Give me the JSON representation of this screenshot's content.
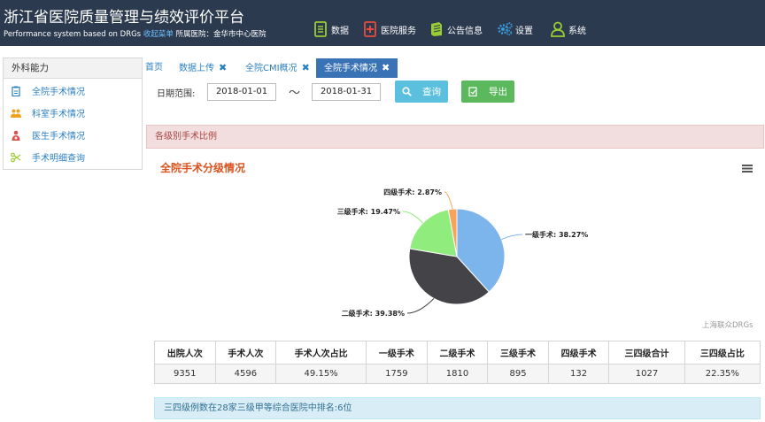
{
  "header": {
    "title": "浙江省医院质量管理与绩效评价平台",
    "subtitle_prefix": "Performance system based on DRGs",
    "subtitle_link": "收起菜单",
    "subtitle_hospital": "所属医院：金华市中心医院",
    "nav": [
      {
        "label": "数据",
        "icon": "document-icon"
      },
      {
        "label": "医院服务",
        "icon": "hospital-service-icon"
      },
      {
        "label": "公告信息",
        "icon": "book-icon"
      },
      {
        "label": "设置",
        "icon": "gear-icon"
      },
      {
        "label": "系统",
        "icon": "user-icon"
      }
    ]
  },
  "sidebar": {
    "title": "外科能力",
    "items": [
      {
        "label": "全院手术情况",
        "icon": "clipboard-icon",
        "color": "#2a7fc0"
      },
      {
        "label": "科室手术情况",
        "icon": "group-icon",
        "color": "#f0a020"
      },
      {
        "label": "医生手术情况",
        "icon": "doctor-icon",
        "color": "#d9534f"
      },
      {
        "label": "手术明细查询",
        "icon": "scissors-icon",
        "color": "#9acd32"
      }
    ]
  },
  "tabs": [
    {
      "label": "首页",
      "closable": false
    },
    {
      "label": "数据上传",
      "closable": true
    },
    {
      "label": "全院CMI概况",
      "closable": true
    },
    {
      "label": "全院手术情况",
      "closable": true,
      "active": true
    }
  ],
  "filter": {
    "date_label": "日期范围:",
    "start_date": "2018-01-01",
    "separator": "～",
    "end_date": "2018-01-31",
    "query_label": "查询",
    "export_label": "导出"
  },
  "panel": {
    "heading": "各级别手术比例",
    "credit": "上海联众DRGs"
  },
  "chart_data": {
    "type": "pie",
    "title": "全院手术分级情况",
    "slices": [
      {
        "name": "一级手术",
        "value": 38.27,
        "label": "一级手术: 38.27%",
        "color": "#7cb5ec"
      },
      {
        "name": "二级手术",
        "value": 39.38,
        "label": "二级手术: 39.38%",
        "color": "#434348"
      },
      {
        "name": "三级手术",
        "value": 19.47,
        "label": "三级手术: 19.47%",
        "color": "#90ed7d"
      },
      {
        "name": "四级手术",
        "value": 2.87,
        "label": "四级手术: 2.87%",
        "color": "#f7a35c"
      }
    ]
  },
  "table": {
    "headers": [
      "出院人次",
      "手术人次",
      "手术人次占比",
      "一级手术",
      "二级手术",
      "三级手术",
      "四级手术",
      "三四级合计",
      "三四级占比"
    ],
    "rows": [
      [
        "9351",
        "4596",
        "49.15%",
        "1759",
        "1810",
        "895",
        "132",
        "1027",
        "22.35%"
      ]
    ]
  },
  "info": {
    "text": "三四级例数在28家三级甲等综合医院中排名:6位"
  }
}
